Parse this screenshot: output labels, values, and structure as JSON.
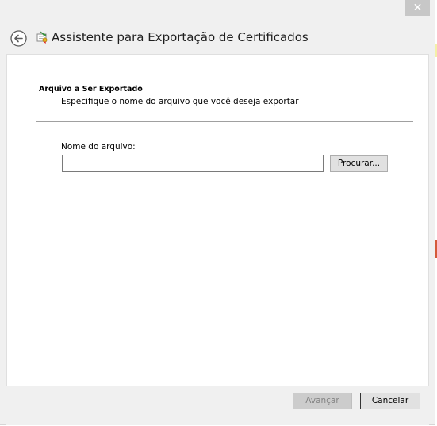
{
  "window": {
    "close_glyph": "✕",
    "close_icon": "close-icon"
  },
  "header": {
    "title": "Assistente para Exportação de Certificados",
    "back_icon": "back-arrow-icon",
    "wizard_icon": "certificate-icon"
  },
  "section": {
    "title": "Arquivo a Ser Exportado",
    "subtitle": "Especifique o nome do arquivo que você deseja exportar"
  },
  "form": {
    "file_label": "Nome do arquivo:",
    "file_value": "",
    "browse_label": "Procurar..."
  },
  "footer": {
    "next_label": "Avançar",
    "cancel_label": "Cancelar"
  },
  "colors": {
    "window_bg": "#f0f0f0",
    "content_bg": "#ffffff",
    "close_bg": "#c7c7c7",
    "disabled_text": "#838383"
  }
}
